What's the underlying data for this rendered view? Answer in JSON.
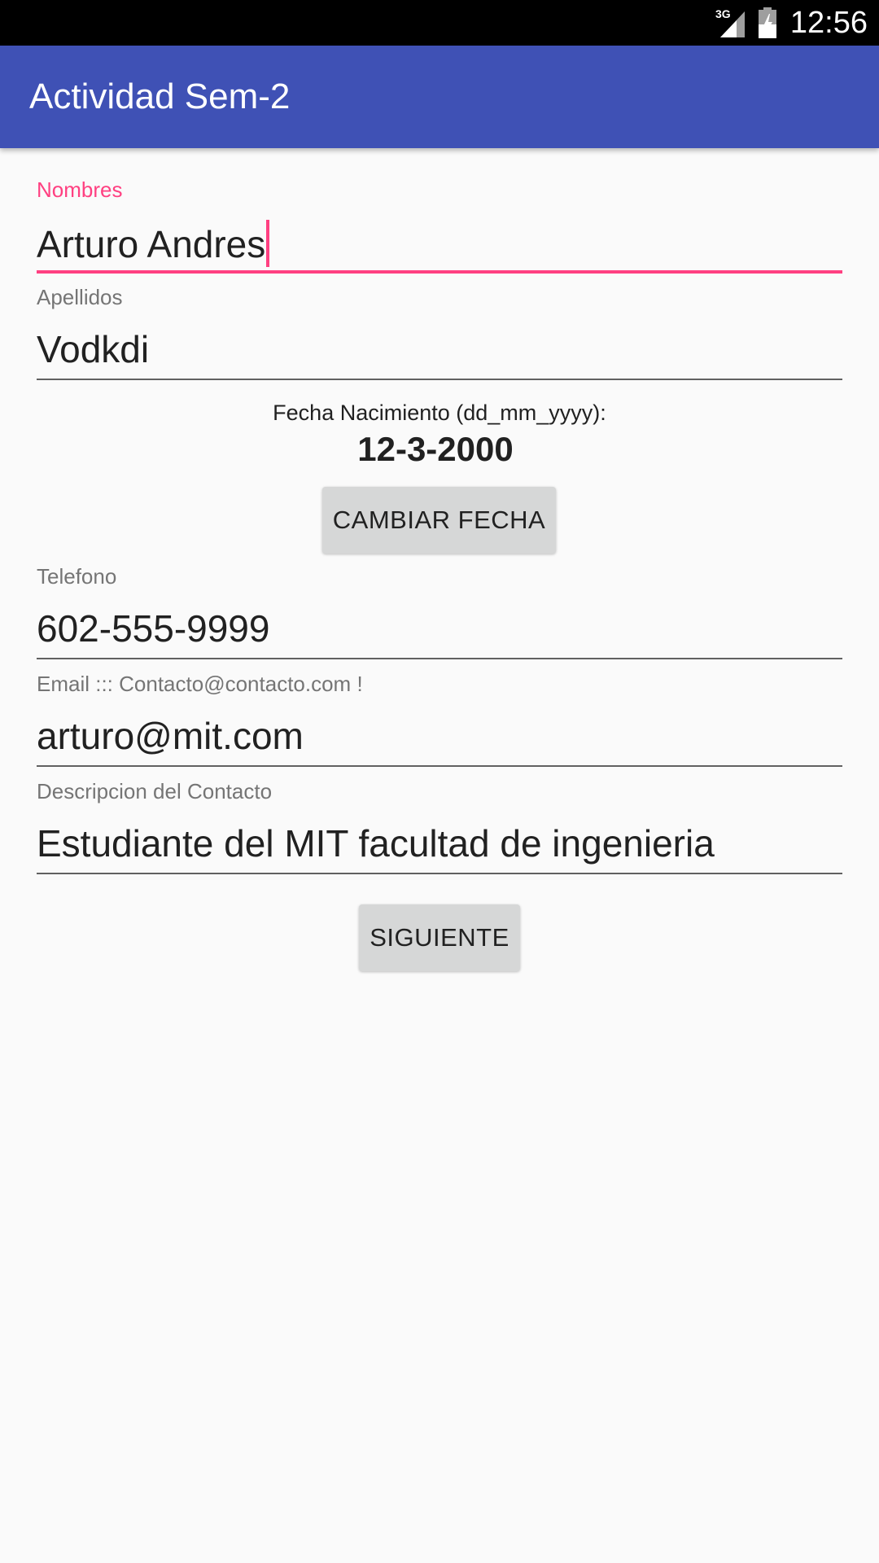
{
  "status_bar": {
    "time": "12:56",
    "network_label": "3G",
    "icons": [
      "signal-icon",
      "battery-icon"
    ]
  },
  "app_bar": {
    "title": "Actividad Sem-2",
    "color": "#3f51b5"
  },
  "form": {
    "nombres": {
      "label": "Nombres",
      "value": "Arturo Andres",
      "focused": true
    },
    "apellidos": {
      "label": "Apellidos",
      "value": "Vodkdi"
    },
    "fecha": {
      "label": "Fecha Nacimiento (dd_mm_yyyy):",
      "value": "12-3-2000"
    },
    "cambiar_fecha_button": "CAMBIAR FECHA",
    "telefono": {
      "label": "Telefono",
      "value": "602-555-9999"
    },
    "email": {
      "label": "Email ::: Contacto@contacto.com !",
      "value": "arturo@mit.com"
    },
    "descripcion": {
      "label": "Descripcion del Contacto",
      "value": "Estudiante del MIT facultad de ingenieria"
    },
    "siguiente_button": "SIGUIENTE"
  },
  "colors": {
    "accent": "#ff4081",
    "primary": "#3f51b5",
    "background": "#fafafa",
    "button": "#d6d7d7"
  }
}
